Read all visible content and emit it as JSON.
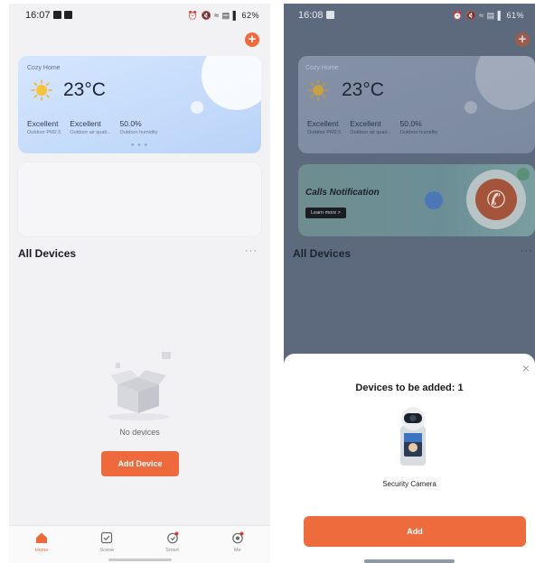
{
  "left": {
    "status_time": "16:07",
    "status_right": "⏰ 🔇 ≈ ▤ ▌ 62%",
    "home_name": "Cozy Home",
    "temperature": "23°C",
    "stats": [
      {
        "value": "Excellent",
        "label": "Outdoor PM2.5"
      },
      {
        "value": "Excellent",
        "label": "Outdoor air quali..."
      },
      {
        "value": "50.0%",
        "label": "Outdoor humidity"
      }
    ],
    "section_title": "All Devices",
    "more": "···",
    "empty_text": "No devices",
    "add_device_label": "Add Device",
    "tabs": [
      {
        "label": "Home",
        "icon": "home-icon"
      },
      {
        "label": "Scene",
        "icon": "checkbox-icon"
      },
      {
        "label": "Smart",
        "icon": "smart-icon"
      },
      {
        "label": "Me",
        "icon": "me-icon"
      }
    ]
  },
  "right": {
    "status_time": "16:08",
    "status_right": "⏰ 🔇 ≈ ▤ ▌ 61%",
    "home_name": "Cozy Home",
    "temperature": "23°C",
    "stats": [
      {
        "value": "Excellent",
        "label": "Outdoor PM2.5"
      },
      {
        "value": "Excellent",
        "label": "Outdoor air quali..."
      },
      {
        "value": "50.0%",
        "label": "Outdoor humidity"
      }
    ],
    "banner_title": "Calls Notification",
    "banner_link": "Learn more >",
    "section_title": "All Devices",
    "more": "···",
    "sheet_title": "Devices to be added: 1",
    "device_name": "Security Camera",
    "add_label": "Add",
    "close": "×"
  },
  "colors": {
    "accent": "#ee6a3d",
    "card": "#c6dcfb"
  }
}
